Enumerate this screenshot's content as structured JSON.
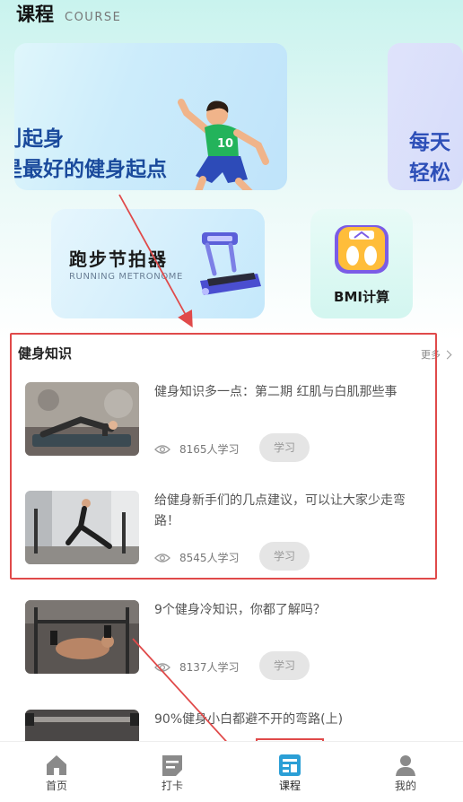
{
  "header": {
    "title": "课程",
    "subtitle": "COURSE"
  },
  "banners": [
    {
      "line1": "刂起身",
      "line2": "是最好的健身起点"
    },
    {
      "line1": "每天",
      "line2": "轻松"
    }
  ],
  "tools": {
    "metronome": {
      "title": "跑步节拍器",
      "subtitle": "RUNNING METRONOME"
    },
    "bmi": {
      "title": "BMI计算"
    }
  },
  "section": {
    "title": "健身知识",
    "more": "更多"
  },
  "articles": [
    {
      "title": "健身知识多一点：第二期 红肌与白肌那些事",
      "views": "8165人学习",
      "button": "学习"
    },
    {
      "title": "给健身新手们的几点建议，可以让大家少走弯路！",
      "views": "8545人学习",
      "button": "学习"
    },
    {
      "title": "9个健身冷知识，你都了解吗？",
      "views": "8137人学习",
      "button": "学习"
    },
    {
      "title": "90%健身小白都避不开的弯路(上)",
      "views": "",
      "button": ""
    }
  ],
  "tabbar": [
    {
      "label": "首页",
      "icon": "home-icon"
    },
    {
      "label": "打卡",
      "icon": "checkin-icon"
    },
    {
      "label": "课程",
      "icon": "course-icon",
      "active": true
    },
    {
      "label": "我的",
      "icon": "profile-icon"
    }
  ],
  "colors": {
    "accent": "#2b9fd6",
    "annotation": "#e04a4a",
    "button_bg": "#e5e5e5"
  }
}
